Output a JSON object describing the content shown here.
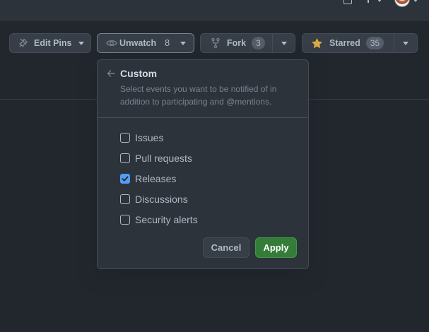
{
  "header": {
    "icons": [
      "bell-icon",
      "plus-icon",
      "avatar"
    ]
  },
  "repo_actions": {
    "edit_pins_label": "Edit Pins",
    "unwatch_label": "Unwatch",
    "unwatch_count": "8",
    "fork_label": "Fork",
    "fork_count": "3",
    "starred_label": "Starred",
    "starred_count": "35",
    "star_color": "#daaa3f"
  },
  "watch_popover": {
    "title": "Custom",
    "description": "Select events you want to be notified of in addition to participating and @mentions.",
    "options": [
      {
        "label": "Issues",
        "checked": false
      },
      {
        "label": "Pull requests",
        "checked": false
      },
      {
        "label": "Releases",
        "checked": true
      },
      {
        "label": "Discussions",
        "checked": false
      },
      {
        "label": "Security alerts",
        "checked": false
      }
    ],
    "cancel_label": "Cancel",
    "apply_label": "Apply"
  },
  "colors": {
    "background": "#22272e",
    "accent_blue": "#539bf5",
    "apply_green": "#347d39"
  }
}
